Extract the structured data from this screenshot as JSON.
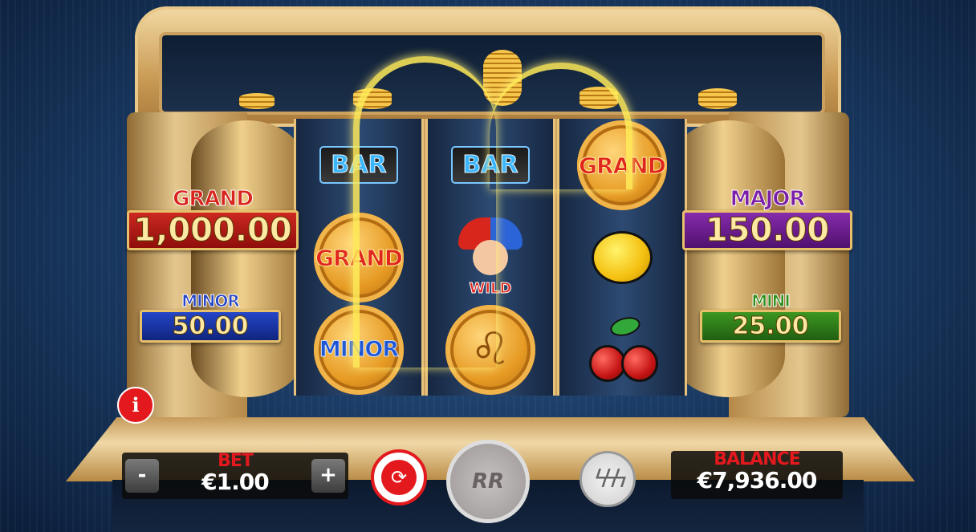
{
  "jackpots": {
    "grand": {
      "label": "GRAND",
      "value": "1,000.00"
    },
    "major": {
      "label": "MAJOR",
      "value": "150.00"
    },
    "minor": {
      "label": "MINOR",
      "value": "50.00"
    },
    "mini": {
      "label": "MINI",
      "value": "25.00"
    }
  },
  "reels": [
    [
      {
        "symbol": "blank",
        "label": ""
      },
      {
        "symbol": "grand-coin",
        "label": "GRAND"
      },
      {
        "symbol": "minor-coin",
        "label": "MINOR"
      }
    ],
    [
      {
        "symbol": "bar",
        "label": "BAR"
      },
      {
        "symbol": "jester-wild",
        "label": "WILD"
      },
      {
        "symbol": "lion-coin",
        "label": ""
      }
    ],
    [
      {
        "symbol": "grand-coin",
        "label": "GRAND"
      },
      {
        "symbol": "lemon",
        "label": ""
      },
      {
        "symbol": "cherry",
        "label": ""
      }
    ]
  ],
  "reel1_top_bar": "BAR",
  "controls": {
    "info": "i",
    "bet_label": "BET",
    "bet_value": "€1.00",
    "minus": "-",
    "plus": "+",
    "spin_label": "RR",
    "balance_label": "BALANCE",
    "balance_value": "€7,936.00"
  },
  "colors": {
    "accent": "#e3191e",
    "grand": "#d12a22",
    "major": "#8a2db0",
    "minor": "#2549cf",
    "mini": "#3f9b22"
  }
}
